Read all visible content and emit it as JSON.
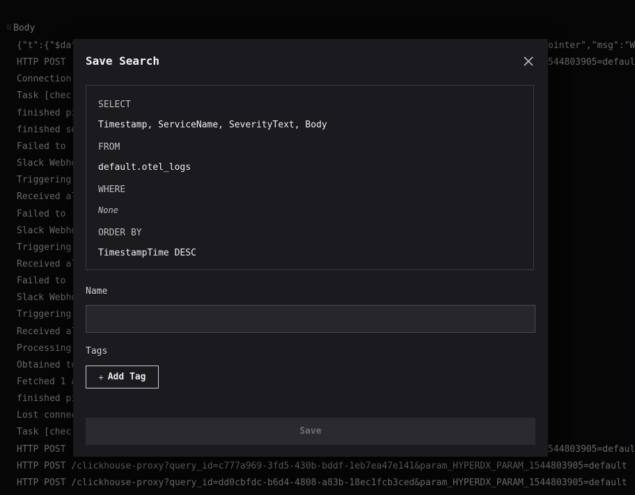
{
  "background": {
    "column_header": "Body",
    "log_lines": [
      {
        "text": "{\"t\":{\"$dat",
        "right": "ointer\",\"msg\":\"W"
      },
      {
        "text": "HTTP POST ",
        "right": "544803905=default"
      },
      {
        "text": "Connection",
        "right": ""
      },
      {
        "text": "Task [chec",
        "right": ""
      },
      {
        "text": "finished pi",
        "right": ""
      },
      {
        "text": "finished se",
        "right": ""
      },
      {
        "text": "Failed to ",
        "right": ""
      },
      {
        "text": "Slack Webho",
        "right": ""
      },
      {
        "text": "Triggering ",
        "right": ""
      },
      {
        "text": "Received al",
        "right": ""
      },
      {
        "text": "Failed to ",
        "right": ""
      },
      {
        "text": "Slack Webho",
        "right": ""
      },
      {
        "text": "Triggering ",
        "right": ""
      },
      {
        "text": "Received al",
        "right": ""
      },
      {
        "text": "Failed to ",
        "right": ""
      },
      {
        "text": "Slack Webho",
        "right": ""
      },
      {
        "text": "Triggering ",
        "right": ""
      },
      {
        "text": "Received al",
        "right": ""
      },
      {
        "text": "Processing ",
        "right": ""
      },
      {
        "text": "Obtained to",
        "right": ""
      },
      {
        "text": "Fetched 1 a",
        "right": ""
      },
      {
        "text": "finished pi",
        "right": ""
      },
      {
        "text": "Lost connec",
        "right": ""
      },
      {
        "text": "Task [chec",
        "right": ""
      },
      {
        "text": "HTTP POST ",
        "right": "544803905=default"
      },
      {
        "text": "HTTP POST /clickhouse-proxy?query_id=c777a969-3fd5-430b-bddf-1eb7ea47e141&param_HYPERDX_PARAM_1544803905=default",
        "right": ""
      },
      {
        "text": "HTTP POST /clickhouse-proxy?query_id=dd0cbfdc-b6d4-4808-a83b-18ec1fcb3ced&param_HYPERDX_PARAM_1544803905=default",
        "right": ""
      }
    ]
  },
  "modal": {
    "title": "Save Search",
    "query": {
      "select_kw": "SELECT",
      "select_val": "Timestamp, ServiceName, SeverityText, Body",
      "from_kw": "FROM",
      "from_val": "default.otel_logs",
      "where_kw": "WHERE",
      "where_val": "None",
      "order_kw": "ORDER BY",
      "order_val": "TimestampTime DESC"
    },
    "name_label": "Name",
    "name_value": "",
    "tags_label": "Tags",
    "add_tag_label": "Add Tag",
    "save_label": "Save"
  },
  "colors": {
    "background": "#0b0b0e",
    "modal": "#1b1b1f",
    "input": "#26262b",
    "save_disabled": "#2a2a2f"
  }
}
